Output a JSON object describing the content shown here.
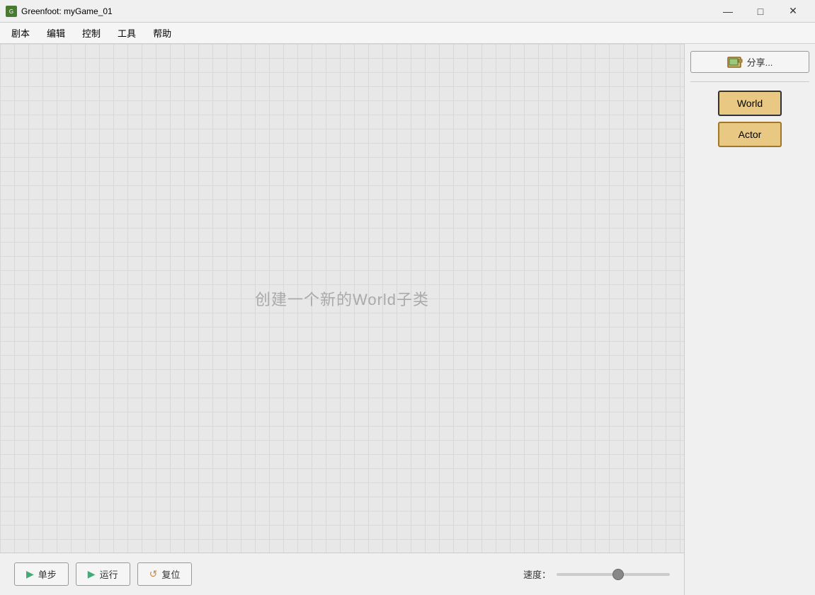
{
  "window": {
    "title": "Greenfoot: myGame_01",
    "icon": "🌿"
  },
  "titlebar": {
    "minimize": "—",
    "maximize": "□",
    "close": "✕"
  },
  "menubar": {
    "items": [
      "剧本",
      "编辑",
      "控制",
      "工具",
      "帮助"
    ]
  },
  "rightpanel": {
    "share_label": "分享...",
    "world_label": "World",
    "actor_label": "Actor"
  },
  "canvas": {
    "placeholder": "创建一个新的World子类"
  },
  "bottombar": {
    "step_label": "单步",
    "run_label": "运行",
    "reset_label": "复位",
    "speed_label": "速度："
  }
}
